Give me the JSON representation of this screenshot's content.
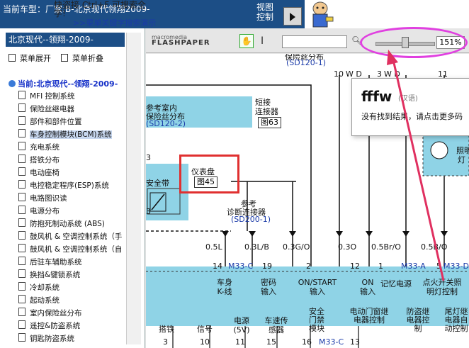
{
  "header": {
    "car_model": "当前车型：厂家:B-北京现代领翔2009-",
    "view_control": "视图控制"
  },
  "banner": {
    "line1": "快盗接  Ctrl+F   可搜索全",
    "line2": "字!",
    "link": ">>菜单关键字搜索演示"
  },
  "sidebar": {
    "header": "北京现代--领翔-2009-",
    "expand": "菜单展开",
    "collapse": "菜单折叠",
    "root": "当前:北京现代--领翔-2009-",
    "items": [
      "MFI 控制系统",
      "保险丝继电器",
      "部件和部件位置",
      "车身控制模块(BCM)系统",
      "充电系统",
      "搭铁分布",
      "电动座椅",
      "电控稳定程序(ESP)系统",
      "电路图识读",
      "电源分布",
      "防抱死制动系统 (ABS)",
      "鼓风机 & 空调控制系统（手",
      "鼓风机 & 空调控制系统（自",
      "后驻车辅助系统",
      "换挡&键锁系统",
      "冷却系统",
      "起动系统",
      "室内保险丝分布",
      "遥控&防盗系统",
      "钥匙防盗系统"
    ],
    "selected_index": 3
  },
  "toolbar": {
    "logo_top": "macromedia",
    "logo_main": "FLASHPAPER",
    "zoom": "151%"
  },
  "popup": {
    "title": "fffw",
    "tag": "(汉语)",
    "body": "没有找到结果，请点击更多码"
  },
  "diagram": {
    "fuse_top": "保险丝分布",
    "sd120_top": "(SD120-1)",
    "ref_interior_1": "参考室内",
    "ref_interior_2": "保险丝分布",
    "sd120_2": "(SD120-2)",
    "short_conn_1": "短接",
    "short_conn_2": "连接器",
    "fig63": "图63",
    "instrument": "仪表盘",
    "fig45": "图45",
    "seatbelt": "安全带",
    "ref_diag_1": "参考",
    "ref_diag_2": "诊断连接器",
    "sd200": "(SD200-1)",
    "num3a": "3",
    "num3b": "3",
    "wires": [
      "0.5L",
      "0.3L/B",
      "0.3G/O",
      "0.3O",
      "0.5Br/O",
      "0.5B/O"
    ],
    "pins": [
      "14",
      "19",
      "2",
      "12",
      "1",
      "5"
    ],
    "conn_m33c": "M33-C",
    "conn_m33a": "M33-A",
    "conn_m33d": "M33-D",
    "func": [
      "车身K-线",
      "密码输入",
      "ON/START输入",
      "ON输入",
      "记忆电源",
      "点火开关照明灯控制"
    ],
    "ecu": [
      "安全门禁模块",
      "电动门窗继电器控制",
      "防盗继电器控制",
      "尾灯继电器自动控制"
    ],
    "bottom": [
      "搭铁",
      "信号",
      "电源(5V)",
      "车速传感器"
    ],
    "bottom_pins": [
      "3",
      "10",
      "11",
      "15",
      "16",
      "13"
    ],
    "bottom_conn": "M33-C",
    "top_right": [
      "10",
      "W D",
      "3",
      "W D",
      "11"
    ],
    "light_1": "照明",
    "light_2": "灯"
  }
}
